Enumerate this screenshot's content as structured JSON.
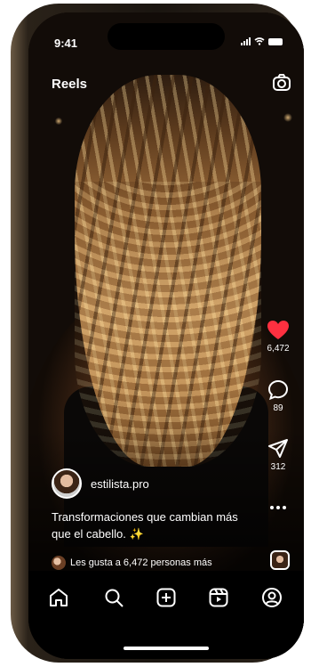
{
  "status_bar": {
    "time": "9:41"
  },
  "header": {
    "title": "Reels",
    "camera_icon": "camera-icon"
  },
  "actions": {
    "like": {
      "icon": "heart-icon",
      "count": "6,472",
      "color": "#ff3040"
    },
    "comment": {
      "icon": "comment-icon",
      "count": "89"
    },
    "share": {
      "icon": "send-icon",
      "count": "312"
    },
    "more": {
      "icon": "more-icon"
    }
  },
  "post": {
    "username": "estilista.pro",
    "caption": "Transformaciones que cambian más que el cabello. ✨",
    "likes_text": "Les gusta a 6,472 personas más"
  },
  "tab_bar": {
    "items": [
      {
        "name": "home",
        "icon": "home-icon"
      },
      {
        "name": "search",
        "icon": "search-icon"
      },
      {
        "name": "create",
        "icon": "add-icon"
      },
      {
        "name": "reels",
        "icon": "reels-icon"
      },
      {
        "name": "profile",
        "icon": "profile-icon"
      }
    ]
  }
}
